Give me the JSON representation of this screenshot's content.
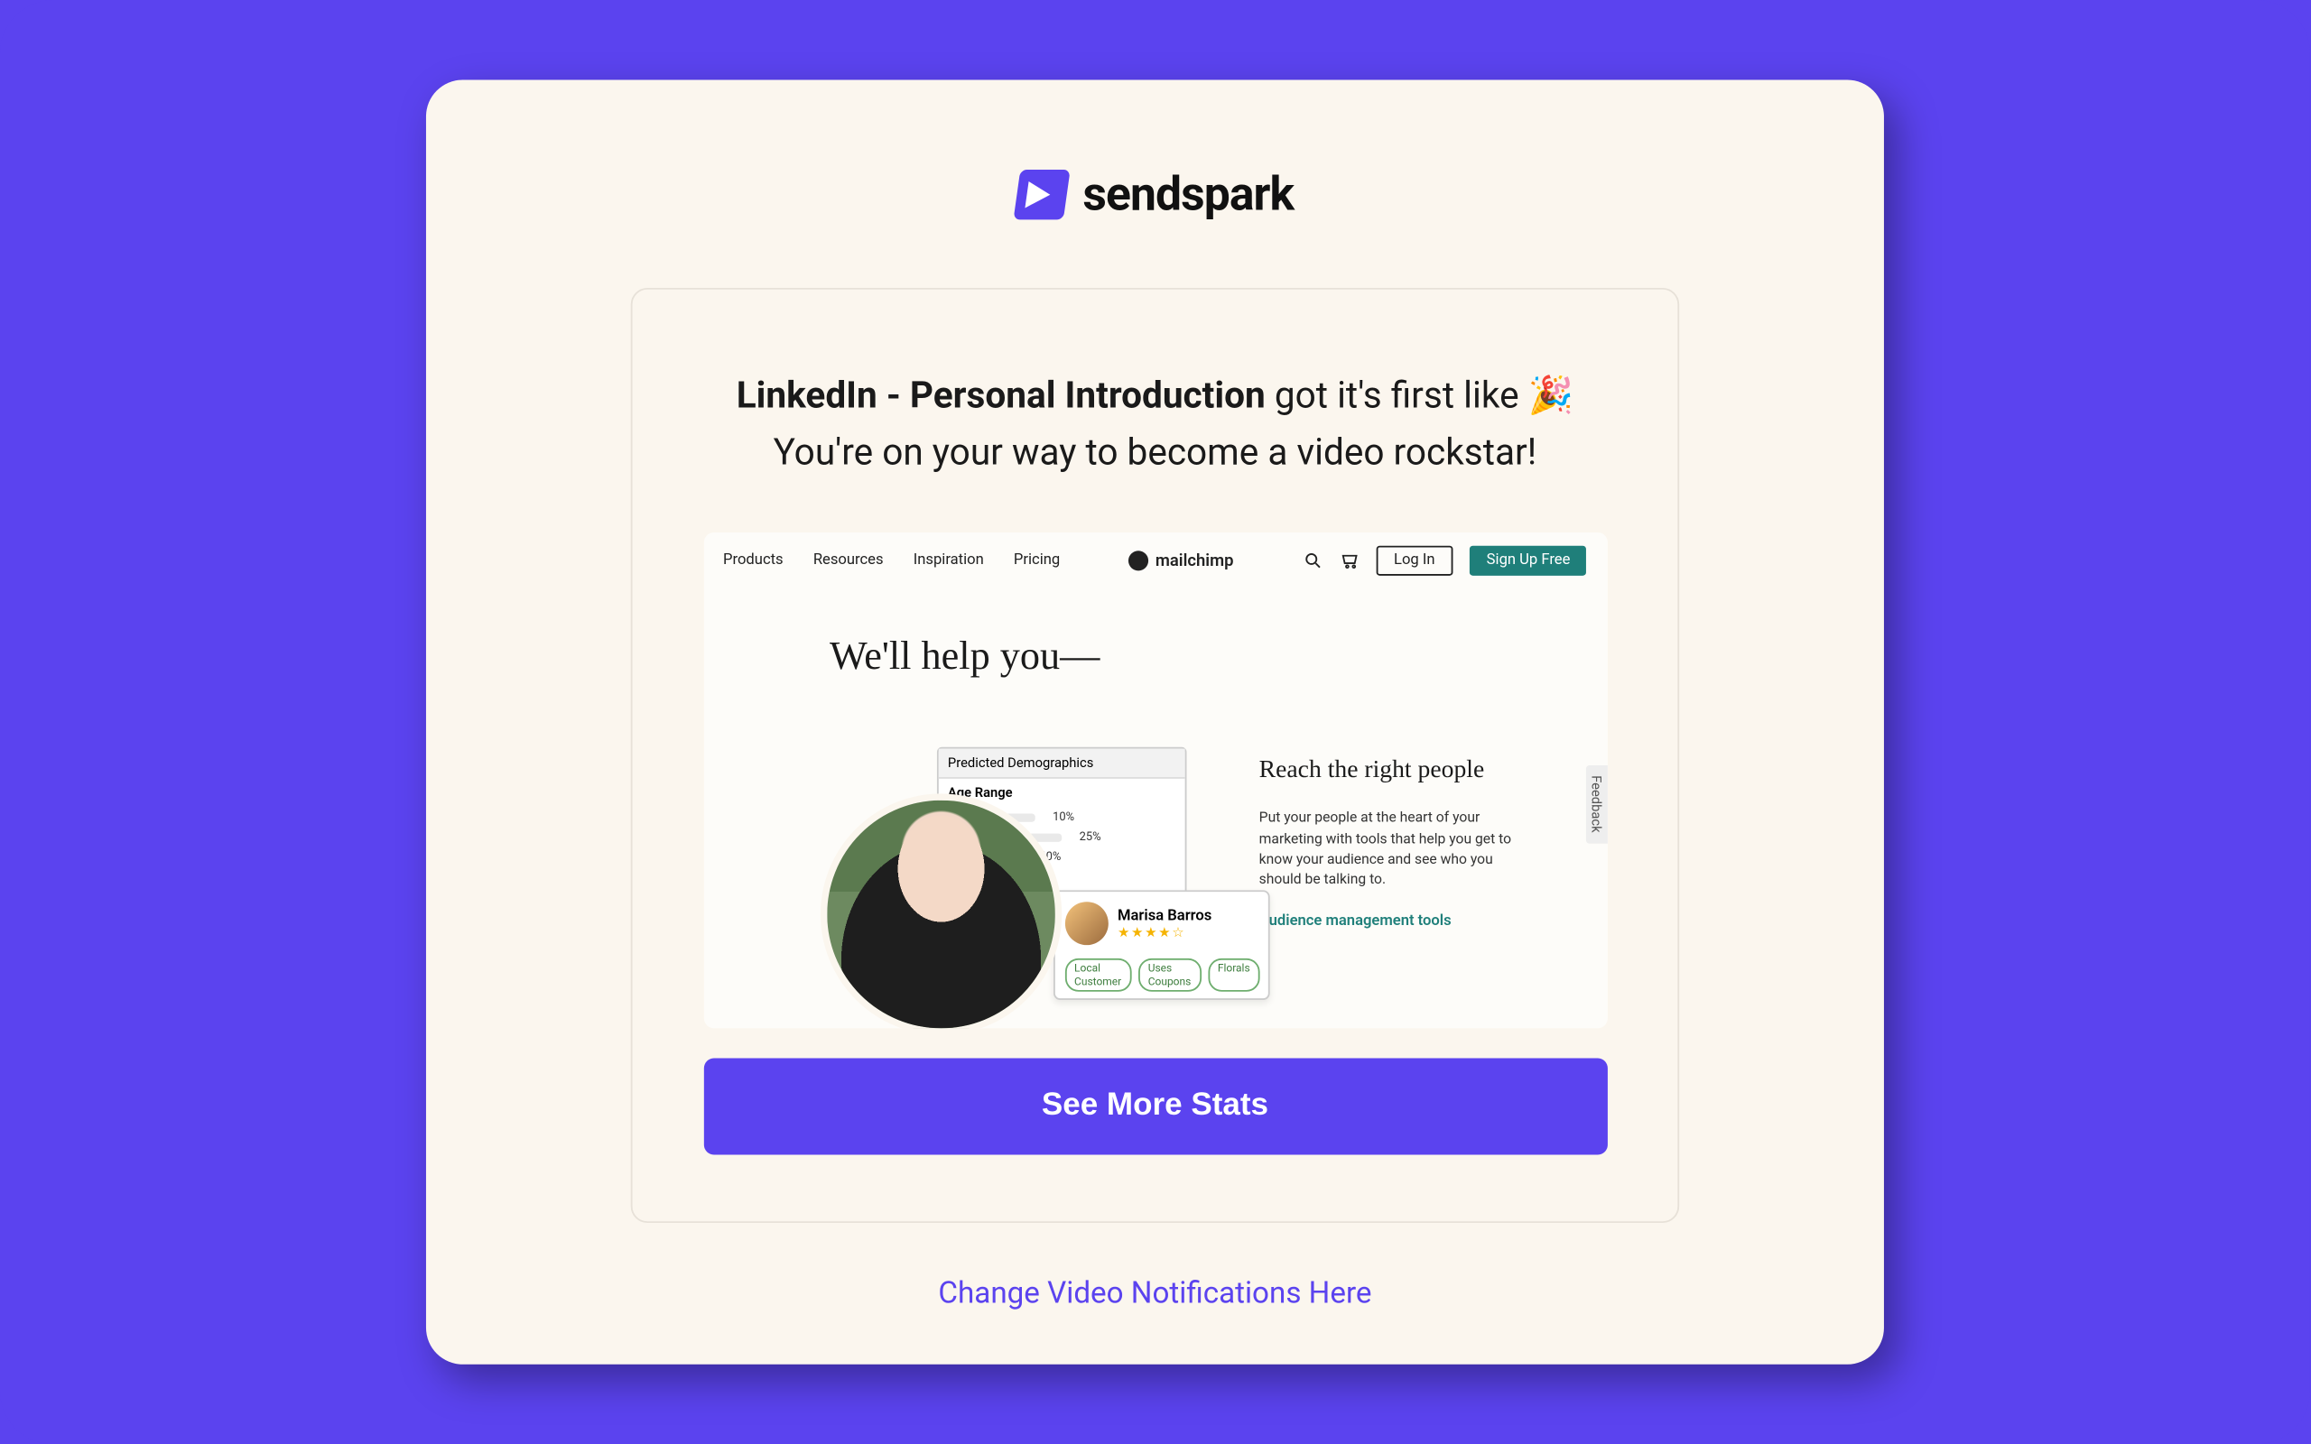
{
  "brand": {
    "name": "sendspark"
  },
  "message": {
    "video_title": "LinkedIn - Personal Introduction",
    "suffix": " got it's first like ",
    "emoji": "🎉",
    "subline": "You're on your way to become a video rockstar!"
  },
  "thumbnail": {
    "nav": [
      "Products",
      "Resources",
      "Inspiration",
      "Pricing"
    ],
    "logo": "mailchimp",
    "login": "Log In",
    "signup": "Sign Up Free",
    "hero": "We'll help you—",
    "demo_title": "Predicted Demographics",
    "demo_section": "Age Range",
    "bars": [
      {
        "pct": "10%",
        "w": 52
      },
      {
        "pct": "25%",
        "w": 68
      },
      {
        "pct": "40%",
        "w": 44
      }
    ],
    "user": {
      "name": "Marisa Barros",
      "stars": "★★★★☆",
      "tags": [
        "Local Customer",
        "Uses Coupons",
        "Florals"
      ]
    },
    "right": {
      "heading": "Reach the right people",
      "body": "Put your people at the heart of your marketing with tools that help you get to know your audience and see who you should be talking to.",
      "link": "Audience management tools"
    },
    "feedback": "Feedback"
  },
  "cta": {
    "label": "See More Stats"
  },
  "footer": {
    "link": "Change Video Notifications Here"
  }
}
